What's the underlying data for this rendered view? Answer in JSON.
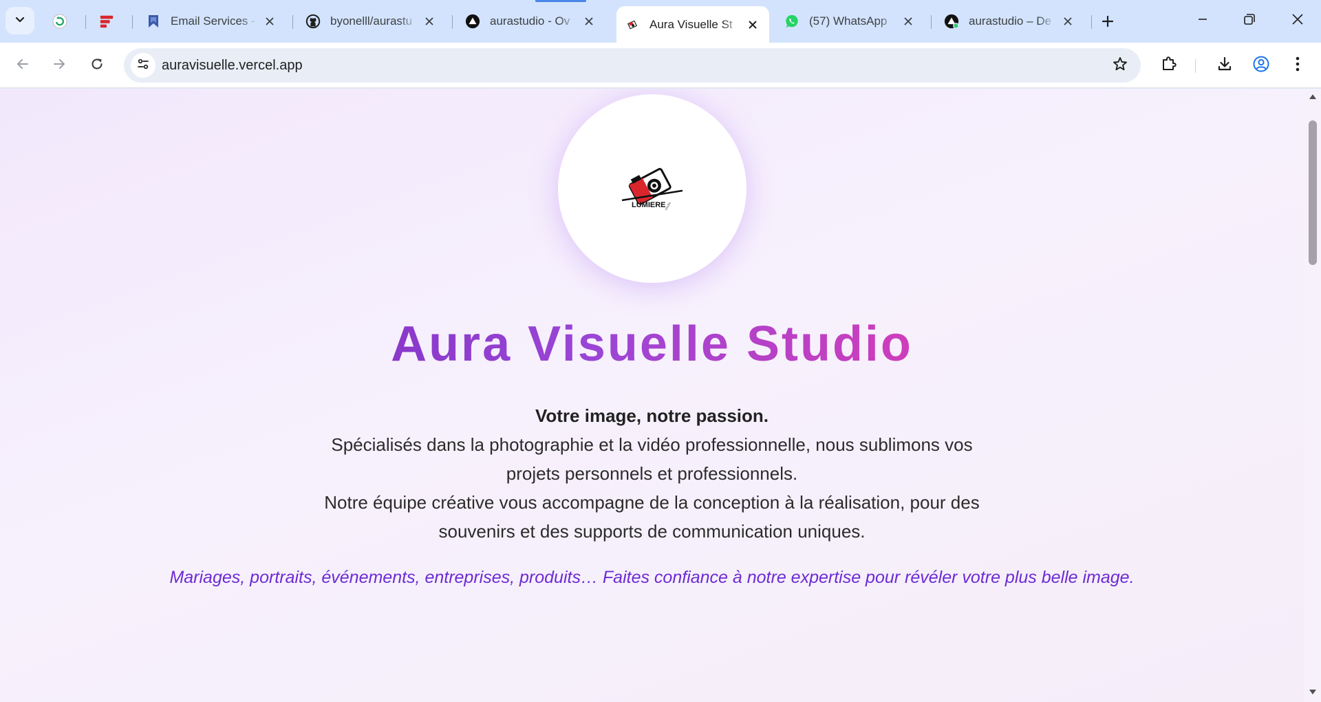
{
  "browser": {
    "tabs": [
      {
        "title": "",
        "icon": "refresh-green-icon",
        "active": false
      },
      {
        "title": "",
        "icon": "red-stack-icon",
        "active": false
      },
      {
        "title": "Email Services - ",
        "icon": "bookmark-blue-icon",
        "active": false
      },
      {
        "title": "byonelll/aurastu",
        "icon": "github-icon",
        "active": false
      },
      {
        "title": "aurastudio - Ov",
        "icon": "vercel-icon",
        "active": false
      },
      {
        "title": "Aura Visuelle St",
        "icon": "camera-logo-icon",
        "active": true
      },
      {
        "title": "(57) WhatsApp",
        "icon": "whatsapp-icon",
        "active": false
      },
      {
        "title": "aurastudio – De",
        "icon": "vercel-icon",
        "active": false
      }
    ],
    "url": "auravisuelle.vercel.app",
    "colors": {
      "tabstrip": "#d3e3fd",
      "toolbar": "#ffffff",
      "omnibox": "#e9eef6"
    }
  },
  "page": {
    "logo": {
      "text": "LUMIERE",
      "sub": "studio"
    },
    "title": "Aura Visuelle Studio",
    "tagline": "Votre image, notre passion.",
    "paragraph_lines": [
      "Spécialisés dans la photographie et la vidéo professionnelle, nous sublimons vos",
      "projets personnels et professionnels.",
      "Notre équipe créative vous accompagne de la conception à la réalisation, pour des",
      "souvenirs et des supports de communication uniques."
    ],
    "services_line": "Mariages, portraits, événements, entreprises, produits… Faites confiance à notre expertise pour révéler votre plus belle image.",
    "colors": {
      "title_start": "#6a1fb0",
      "title_end": "#f0307c",
      "italic": "#6d2bd4",
      "background": "#f2e8fc"
    }
  }
}
